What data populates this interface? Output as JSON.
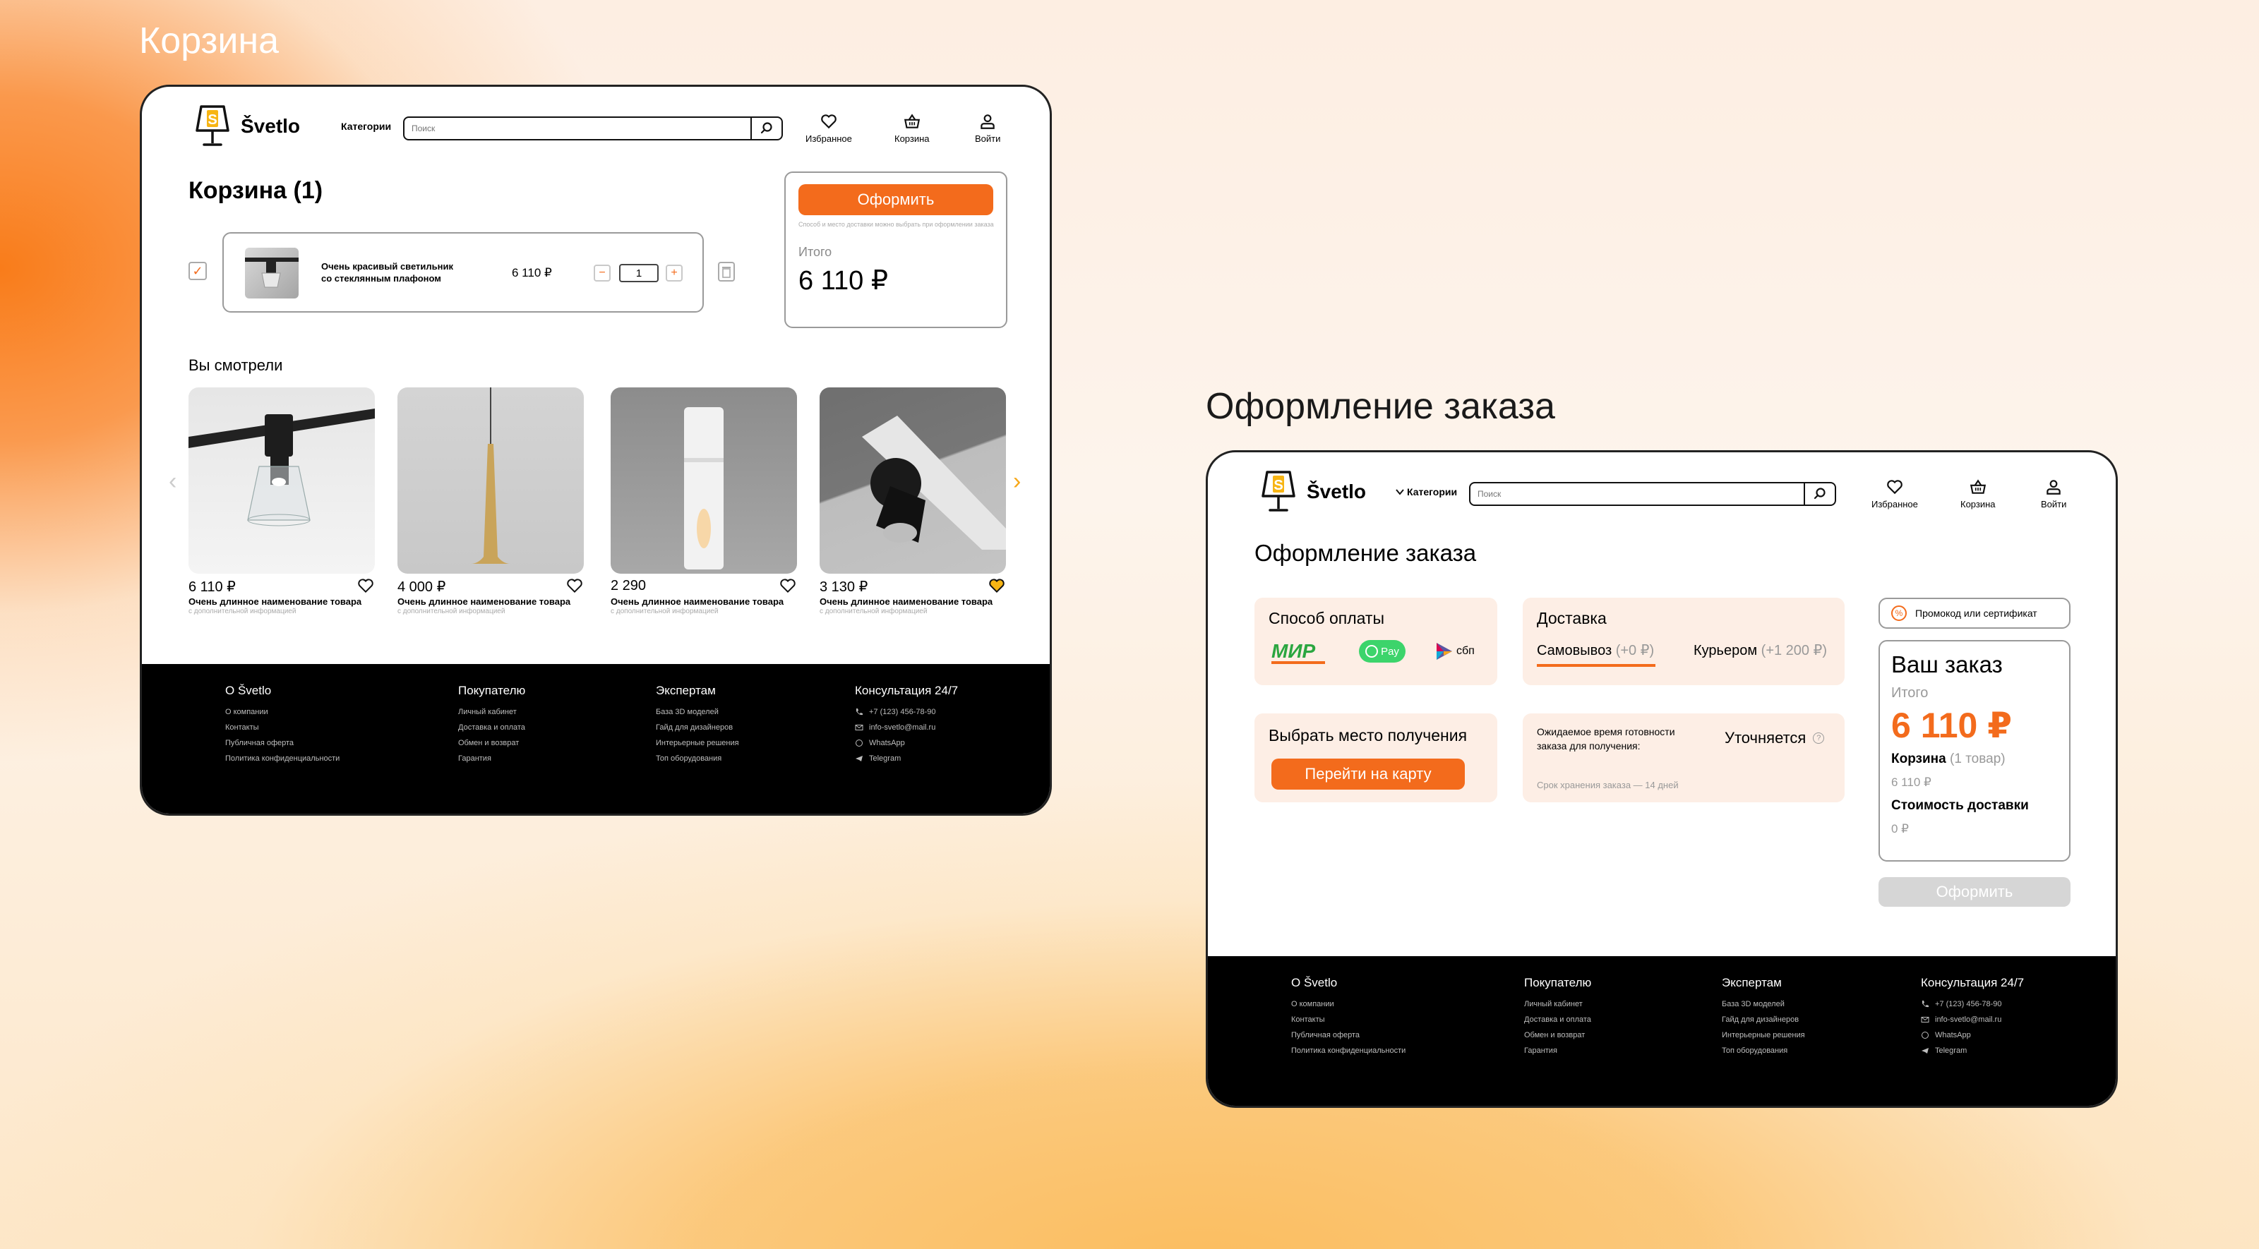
{
  "cart_section_title": "Корзина",
  "checkout_section_title": "Оформление заказа",
  "brand": "Švetlo",
  "header": {
    "categories": "Категории",
    "search_placeholder": "Поиск",
    "favorites": "Избранное",
    "cart": "Корзина",
    "login": "Войти"
  },
  "cart": {
    "title": "Корзина (1)",
    "item": {
      "name_line1": "Очень красивый светильник",
      "name_line2": "со стеклянным плафоном",
      "price": "6 110 ₽",
      "qty": "1",
      "minus": "−",
      "plus": "+"
    },
    "summary": {
      "checkout_button": "Оформить",
      "note": "Способ и место доставки можно выбрать при оформлении заказа",
      "total_label": "Итого",
      "total_value": "6 110 ₽"
    },
    "viewed_title": "Вы смотрели",
    "products": [
      {
        "price": "6 110 ₽",
        "name": "Очень длинное наименование товара",
        "sub": "с дополнительной информацией",
        "favorite": false
      },
      {
        "price": "4 000 ₽",
        "name": "Очень длинное наименование товара",
        "sub": "с дополнительной информацией",
        "favorite": false
      },
      {
        "price": "2 290",
        "name": "Очень длинное наименование товара",
        "sub": "с дополнительной информацией",
        "favorite": false
      },
      {
        "price": "3 130 ₽",
        "name": "Очень длинное наименование товара",
        "sub": "с дополнительной информацией",
        "favorite": true
      }
    ]
  },
  "checkout": {
    "title": "Оформление заказа",
    "payment_title": "Способ оплаты",
    "payment_methods": [
      "МИР",
      "Pay",
      "сбп"
    ],
    "delivery_title": "Доставка",
    "pickup_label": "Самовывоз",
    "pickup_price": "(+0 ₽)",
    "courier_label": "Курьером",
    "courier_price": "(+1 200 ₽)",
    "pickup_place_title": "Выбрать место получения",
    "map_button": "Перейти на карту",
    "ready_time_label_1": "Ожидаемое время готовности",
    "ready_time_label_2": "заказа для получения:",
    "ready_time_value": "Уточняется",
    "storage_note": "Срок хранения заказа — 14 дней",
    "promo_button": "Промокод или сертификат",
    "order_title": "Ваш заказ",
    "total_label": "Итого",
    "total_value": "6 110 ₽",
    "cart_label": "Корзина",
    "cart_count": "(1 товар)",
    "cart_sum": "6 110 ₽",
    "delivery_cost_label": "Стоимость доставки",
    "delivery_cost_value": "0 ₽",
    "checkout_button": "Оформить"
  },
  "footer": {
    "col1_title": "О Švetlo",
    "col1_links": [
      "О компании",
      "Контакты",
      "Публичная оферта",
      "Политика конфиденциальности"
    ],
    "col2_title": "Покупателю",
    "col2_links": [
      "Личный кабинет",
      "Доставка и оплата",
      "Обмен и возврат",
      "Гарантия"
    ],
    "col3_title": "Экспертам",
    "col3_links": [
      "База 3D моделей",
      "Гайд для дизайнеров",
      "Интерьерные решения",
      "Топ оборудования"
    ],
    "col4_title": "Консультация 24/7",
    "col4_links": [
      "+7 (123) 456-78-90",
      "info-svetlo@mail.ru",
      "WhatsApp",
      "Telegram"
    ]
  },
  "colors": {
    "accent": "#f36b1c",
    "peach": "#fdeee5",
    "footer": "#000000"
  }
}
